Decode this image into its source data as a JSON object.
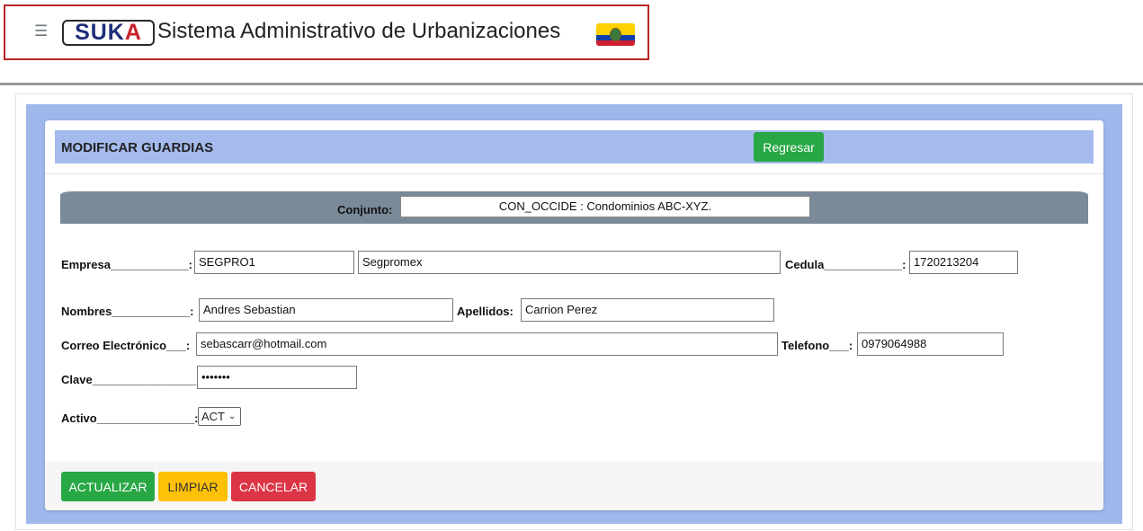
{
  "header": {
    "menu_icon": "☰",
    "logo": {
      "part1": "SUK",
      "part2": "A"
    },
    "title": "Sistema Administrativo de Urbanizaciones",
    "flag_icon": "ecuador-flag-icon"
  },
  "card": {
    "title": "MODIFICAR GUARDIAS",
    "back_label": "Regresar"
  },
  "conjunto": {
    "label": "Conjunto:",
    "value": "CON_OCCIDE : Condominios ABC-XYZ."
  },
  "form": {
    "empresa_label": "Empresa____________:",
    "empresa_code": "SEGPRO1",
    "empresa_name": "Segpromex",
    "cedula_label": "Cedula____________:",
    "cedula_value": "1720213204",
    "nombres_label": "Nombres____________:",
    "nombres_value": "Andres Sebastian",
    "apellidos_label": "Apellidos:",
    "apellidos_value": "Carrion Perez",
    "correo_label": "Correo Electrónico___:",
    "correo_value": "sebascarr@hotmail.com",
    "telefono_label": "Telefono___:",
    "telefono_value": "0979064988",
    "clave_label": "Clave________________:",
    "clave_value": "•••••••",
    "activo_label": "Activo_______________:",
    "activo_value": "ACT"
  },
  "actions": {
    "update": "ACTUALIZAR",
    "clear": "LIMPIAR",
    "cancel": "CANCELAR"
  },
  "colors": {
    "update": "#28a745",
    "clear": "#ffc107",
    "cancel": "#dc3545",
    "header_bg": "#a5bbee",
    "wrap_bg": "#9fb8ec",
    "conjunto_bar": "#7a8a99"
  }
}
